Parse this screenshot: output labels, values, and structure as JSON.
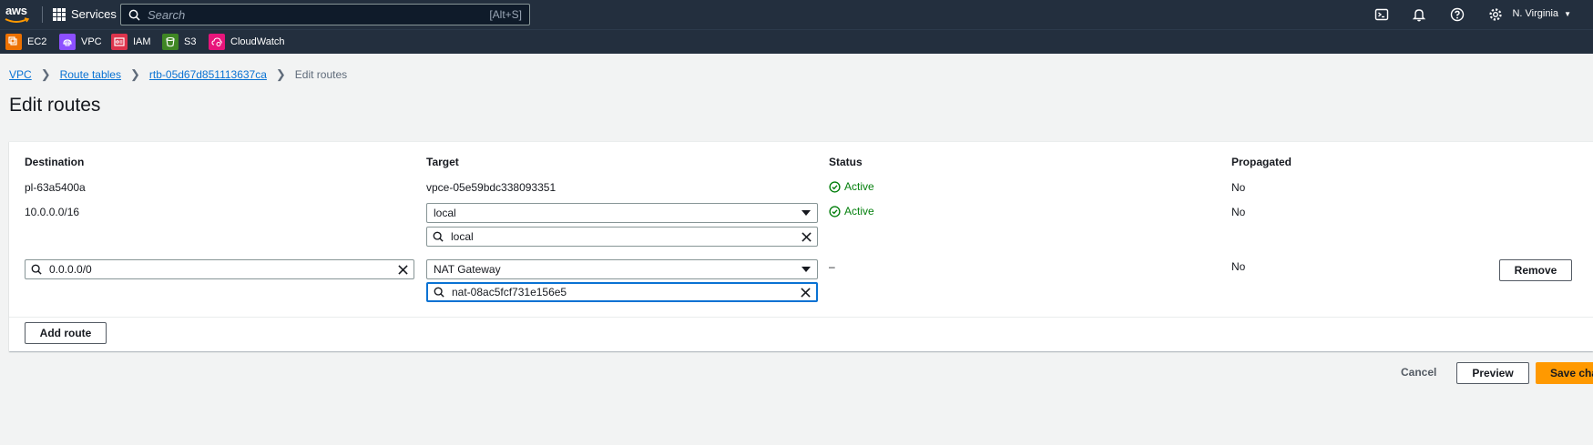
{
  "nav": {
    "logo": "aws",
    "services_label": "Services",
    "search_placeholder": "Search",
    "search_shortcut": "[Alt+S]",
    "region": "N. Virginia"
  },
  "favorites": [
    {
      "label": "EC2",
      "color": "#ed7100"
    },
    {
      "label": "VPC",
      "color": "#8c4fff"
    },
    {
      "label": "IAM",
      "color": "#dd344c"
    },
    {
      "label": "S3",
      "color": "#3f8624"
    },
    {
      "label": "CloudWatch",
      "color": "#e7157b"
    }
  ],
  "breadcrumb": {
    "vpc": "VPC",
    "route_tables": "Route tables",
    "rtb": "rtb-05d67d851113637ca",
    "current": "Edit routes"
  },
  "page_title": "Edit routes",
  "table": {
    "headers": {
      "destination": "Destination",
      "target": "Target",
      "status": "Status",
      "propagated": "Propagated"
    },
    "row1": {
      "destination": "pl-63a5400a",
      "target": "vpce-05e59bdc338093351",
      "status": "Active",
      "propagated": "No"
    },
    "row2": {
      "destination": "10.0.0.0/16",
      "target_type": "local",
      "target_value": "local",
      "status": "Active",
      "propagated": "No"
    },
    "row3": {
      "destination": "0.0.0.0/0",
      "target_type": "NAT Gateway",
      "target_value": "nat-08ac5fcf731e156e5",
      "status": "–",
      "propagated": "No",
      "remove_label": "Remove"
    }
  },
  "add_route_label": "Add route",
  "footer": {
    "cancel": "Cancel",
    "preview": "Preview",
    "save": "Save changes"
  },
  "colors": {
    "accent": "#0972d3",
    "active": "#037f0c",
    "primary": "#ff9900",
    "nav_bg": "#232f3e"
  }
}
